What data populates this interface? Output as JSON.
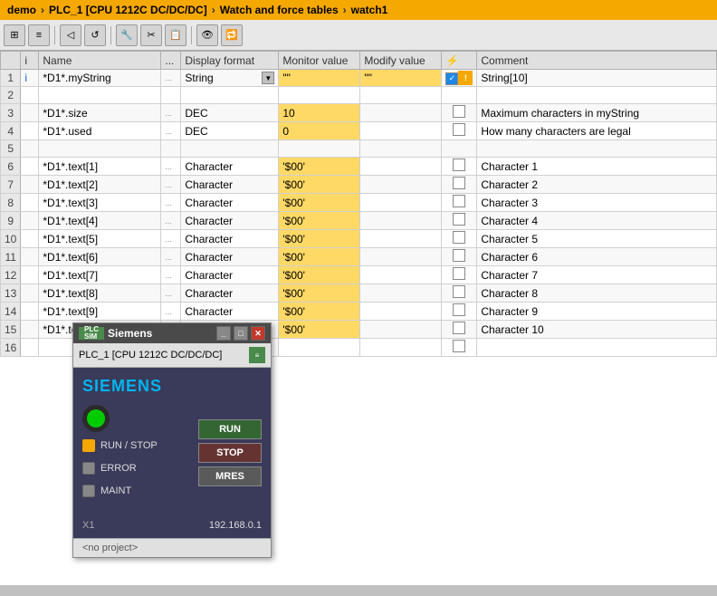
{
  "titlebar": {
    "project": "demo",
    "plc": "PLC_1 [CPU 1212C DC/DC/DC]",
    "section": "Watch and force tables",
    "table": "watch1"
  },
  "table": {
    "columns": [
      "i",
      "Name",
      "...",
      "Display format",
      "Monitor value",
      "Modify value",
      "⚡",
      "Comment"
    ],
    "rows": [
      {
        "num": "1",
        "name": "*D1*.myString",
        "icon": true,
        "dots": "...",
        "format": "String",
        "has_dropdown": true,
        "monitor": "\"\"",
        "modify": "\"\"",
        "checked": true,
        "warning": true,
        "comment": "String[10]"
      },
      {
        "num": "2",
        "name": "",
        "icon": false,
        "dots": "",
        "format": "",
        "has_dropdown": false,
        "monitor": "",
        "modify": "",
        "checked": false,
        "warning": false,
        "comment": ""
      },
      {
        "num": "3",
        "name": "*D1*.size",
        "icon": false,
        "dots": "...",
        "format": "DEC",
        "has_dropdown": false,
        "monitor": "10",
        "modify": "",
        "checked": false,
        "warning": false,
        "comment": "Maximum characters in myString"
      },
      {
        "num": "4",
        "name": "*D1*.used",
        "icon": false,
        "dots": "...",
        "format": "DEC",
        "has_dropdown": false,
        "monitor": "0",
        "modify": "",
        "checked": false,
        "warning": false,
        "comment": "How many characters are legal"
      },
      {
        "num": "5",
        "name": "",
        "icon": false,
        "dots": "",
        "format": "",
        "has_dropdown": false,
        "monitor": "",
        "modify": "",
        "checked": false,
        "warning": false,
        "comment": ""
      },
      {
        "num": "6",
        "name": "*D1*.text[1]",
        "icon": false,
        "dots": "...",
        "format": "Character",
        "has_dropdown": false,
        "monitor": "'$00'",
        "modify": "",
        "checked": false,
        "warning": false,
        "comment": "Character 1"
      },
      {
        "num": "7",
        "name": "*D1*.text[2]",
        "icon": false,
        "dots": "...",
        "format": "Character",
        "has_dropdown": false,
        "monitor": "'$00'",
        "modify": "",
        "checked": false,
        "warning": false,
        "comment": "Character 2"
      },
      {
        "num": "8",
        "name": "*D1*.text[3]",
        "icon": false,
        "dots": "...",
        "format": "Character",
        "has_dropdown": false,
        "monitor": "'$00'",
        "modify": "",
        "checked": false,
        "warning": false,
        "comment": "Character 3"
      },
      {
        "num": "9",
        "name": "*D1*.text[4]",
        "icon": false,
        "dots": "...",
        "format": "Character",
        "has_dropdown": false,
        "monitor": "'$00'",
        "modify": "",
        "checked": false,
        "warning": false,
        "comment": "Character 4"
      },
      {
        "num": "10",
        "name": "*D1*.text[5]",
        "icon": false,
        "dots": "...",
        "format": "Character",
        "has_dropdown": false,
        "monitor": "'$00'",
        "modify": "",
        "checked": false,
        "warning": false,
        "comment": "Character 5"
      },
      {
        "num": "11",
        "name": "*D1*.text[6]",
        "icon": false,
        "dots": "...",
        "format": "Character",
        "has_dropdown": false,
        "monitor": "'$00'",
        "modify": "",
        "checked": false,
        "warning": false,
        "comment": "Character 6"
      },
      {
        "num": "12",
        "name": "*D1*.text[7]",
        "icon": false,
        "dots": "...",
        "format": "Character",
        "has_dropdown": false,
        "monitor": "'$00'",
        "modify": "",
        "checked": false,
        "warning": false,
        "comment": "Character 7"
      },
      {
        "num": "13",
        "name": "*D1*.text[8]",
        "icon": false,
        "dots": "...",
        "format": "Character",
        "has_dropdown": false,
        "monitor": "'$00'",
        "modify": "",
        "checked": false,
        "warning": false,
        "comment": "Character 8"
      },
      {
        "num": "14",
        "name": "*D1*.text[9]",
        "icon": false,
        "dots": "...",
        "format": "Character",
        "has_dropdown": false,
        "monitor": "'$00'",
        "modify": "",
        "checked": false,
        "warning": false,
        "comment": "Character 9"
      },
      {
        "num": "15",
        "name": "*D1*.text[10]",
        "icon": false,
        "dots": "...",
        "format": "Character",
        "has_dropdown": false,
        "monitor": "'$00'",
        "modify": "",
        "checked": false,
        "warning": false,
        "comment": "Character 10"
      },
      {
        "num": "16",
        "name": "",
        "icon": false,
        "dots": "",
        "format": "",
        "has_dropdown": false,
        "monitor": "",
        "modify": "",
        "checked": false,
        "warning": false,
        "comment": ""
      }
    ]
  },
  "dialog": {
    "title": "Siemens",
    "plc_label": "PLC_1 [CPU 1212C DC/DC/DC]",
    "brand": "SIEMENS",
    "run_label": "RUN",
    "stop_label": "STOP",
    "mres_label": "MRES",
    "run_stop_label": "RUN / STOP",
    "error_label": "ERROR",
    "maint_label": "MAINT",
    "x1_label": "X1",
    "ip_address": "192.168.0.1",
    "no_project": "<no project>"
  }
}
